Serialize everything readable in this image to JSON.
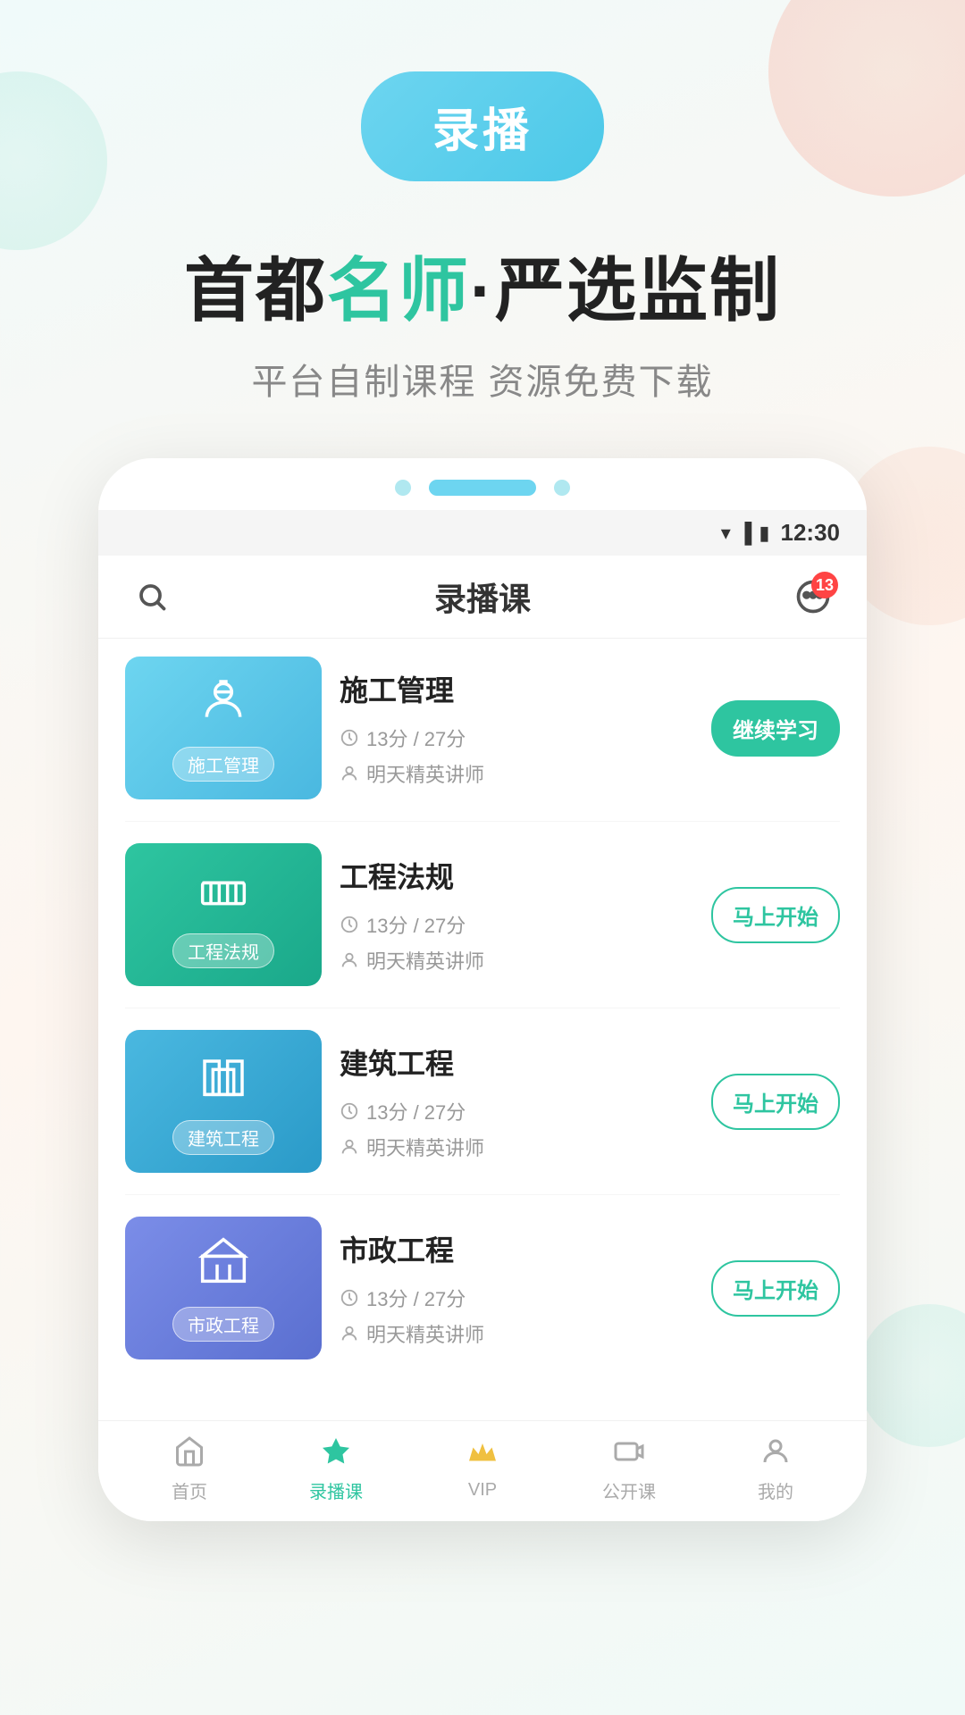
{
  "app": {
    "recording_badge": "录播",
    "headline_part1": "首都",
    "headline_highlight": "名师",
    "headline_part2": "·严选监制",
    "subtitle": "平台自制课程  资源免费下载"
  },
  "phone": {
    "dots": {
      "left": "•",
      "middle": "—",
      "right": "•"
    },
    "status_bar": {
      "time": "12:30"
    },
    "header": {
      "title": "录播课",
      "notification_count": "13"
    }
  },
  "courses": [
    {
      "id": "shigong",
      "name": "施工管理",
      "thumb_label": "施工管理",
      "thumb_class": "thumb-shigong",
      "icon": "👷",
      "duration": "13分",
      "total": "27分",
      "teacher": "明天精英讲师",
      "action_label": "继续学习",
      "action_type": "continue"
    },
    {
      "id": "gongcheng",
      "name": "工程法规",
      "thumb_label": "工程法规",
      "thumb_class": "thumb-gongcheng",
      "icon": "🚧",
      "duration": "13分",
      "total": "27分",
      "teacher": "明天精英讲师",
      "action_label": "马上开始",
      "action_type": "start"
    },
    {
      "id": "jianzhu",
      "name": "建筑工程",
      "thumb_label": "建筑工程",
      "thumb_class": "thumb-jianzhu",
      "icon": "🏢",
      "duration": "13分",
      "total": "27分",
      "teacher": "明天精英讲师",
      "action_label": "马上开始",
      "action_type": "start"
    },
    {
      "id": "shizheng",
      "name": "市政工程",
      "thumb_label": "市政工程",
      "thumb_class": "thumb-shizheng",
      "icon": "🏛",
      "duration": "13分",
      "total": "27分",
      "teacher": "明天精英讲师",
      "action_label": "马上开始",
      "action_type": "start"
    }
  ],
  "bottom_nav": [
    {
      "id": "home",
      "label": "首页",
      "icon": "🏠",
      "active": false
    },
    {
      "id": "recording",
      "label": "录播课",
      "icon": "⭐",
      "active": true
    },
    {
      "id": "vip",
      "label": "VIP",
      "icon": "👑",
      "active": false
    },
    {
      "id": "live",
      "label": "公开课",
      "icon": "📹",
      "active": false
    },
    {
      "id": "mine",
      "label": "我的",
      "icon": "👤",
      "active": false
    }
  ]
}
